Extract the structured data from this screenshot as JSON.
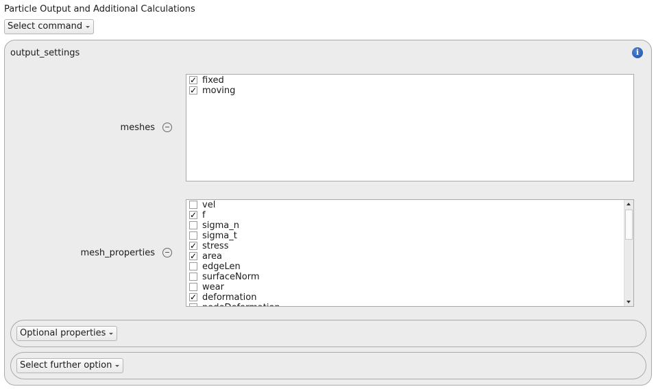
{
  "title": "Particle Output and Additional Calculations",
  "command_select": {
    "label": "Select command"
  },
  "group": {
    "label": "output_settings",
    "info_icon": "info-icon"
  },
  "meshes": {
    "label": "meshes",
    "items": [
      {
        "label": "fixed",
        "checked": true
      },
      {
        "label": "moving",
        "checked": true
      }
    ]
  },
  "mesh_properties": {
    "label": "mesh_properties",
    "items": [
      {
        "label": "vel",
        "checked": false
      },
      {
        "label": "f",
        "checked": true
      },
      {
        "label": "sigma_n",
        "checked": false
      },
      {
        "label": "sigma_t",
        "checked": false
      },
      {
        "label": "stress",
        "checked": true
      },
      {
        "label": "area",
        "checked": true
      },
      {
        "label": "edgeLen",
        "checked": false
      },
      {
        "label": "surfaceNorm",
        "checked": false
      },
      {
        "label": "wear",
        "checked": false
      },
      {
        "label": "deformation",
        "checked": true
      },
      {
        "label": "nodeDeformation",
        "checked": false
      }
    ]
  },
  "optional_select": {
    "label": "Optional properties"
  },
  "further_select": {
    "label": "Select further option"
  },
  "check_glyph": "✓"
}
